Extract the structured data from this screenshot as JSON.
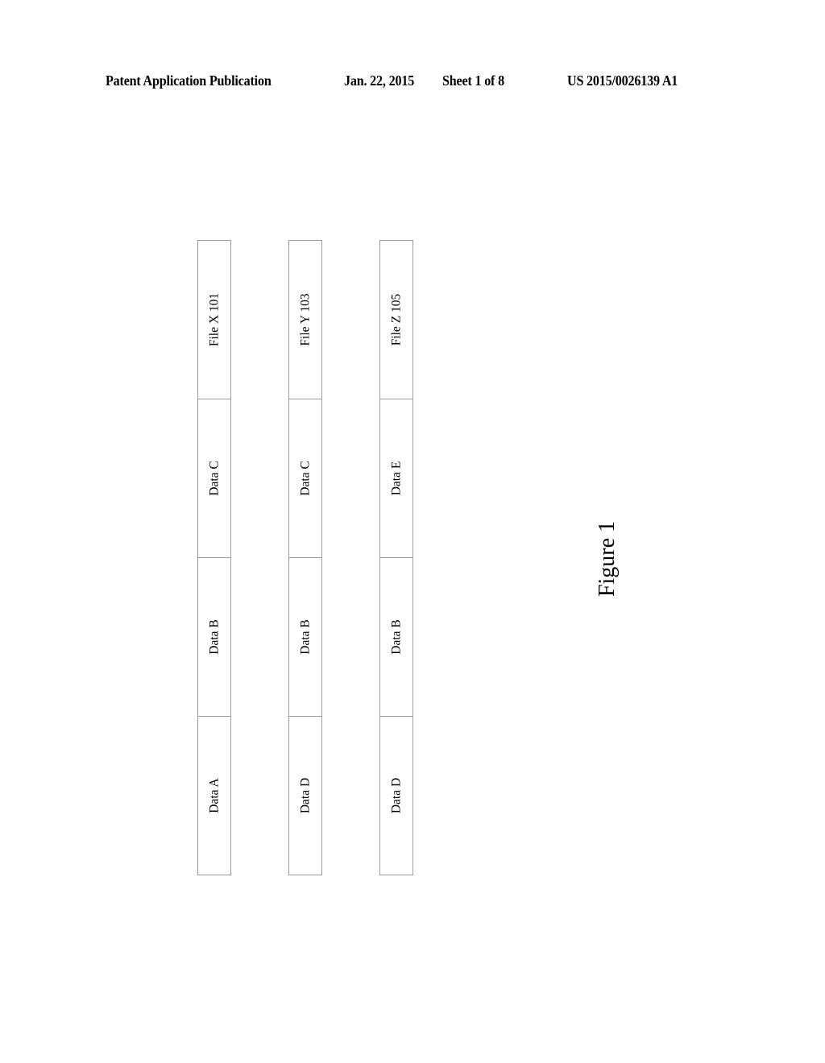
{
  "header": {
    "publication_type": "Patent Application Publication",
    "date": "Jan. 22, 2015",
    "sheet": "Sheet 1 of 8",
    "publication_number": "US 2015/0026139 A1"
  },
  "figure": {
    "caption": "Figure 1",
    "files": [
      {
        "label": "File X 101",
        "data_blocks": [
          "Data C",
          "Data B",
          "Data A"
        ]
      },
      {
        "label": "File Y 103",
        "data_blocks": [
          "Data C",
          "Data B",
          "Data D"
        ]
      },
      {
        "label": "File Z 105",
        "data_blocks": [
          "Data E",
          "Data B",
          "Data D"
        ]
      }
    ]
  }
}
